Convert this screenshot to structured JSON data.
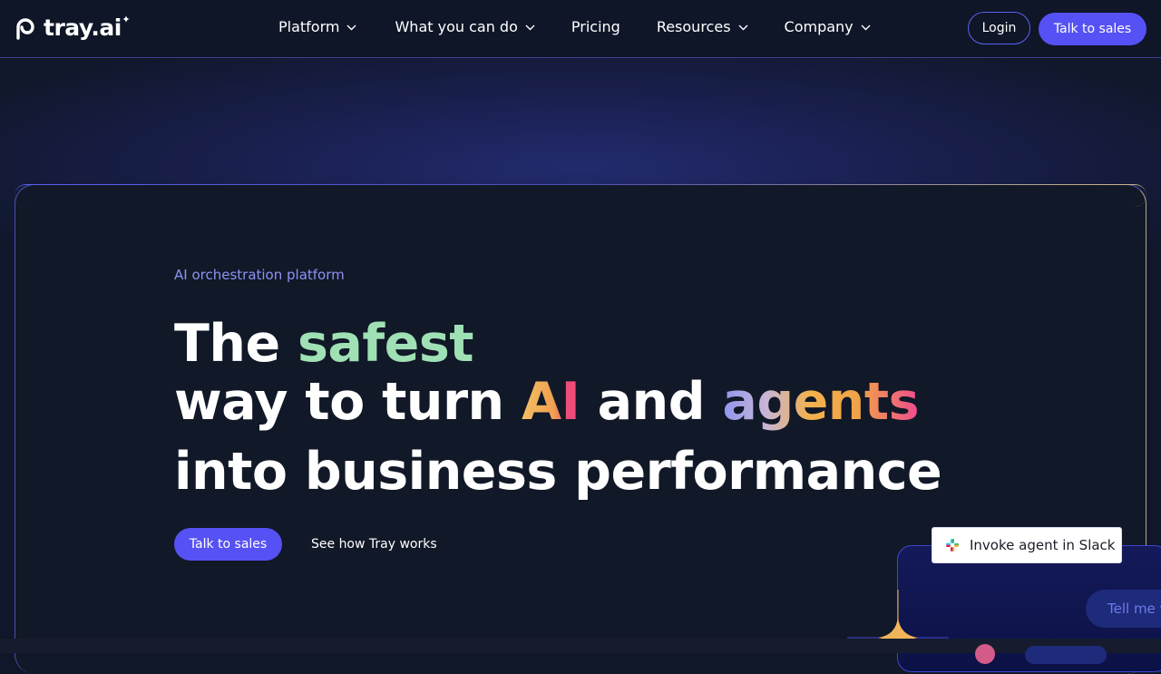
{
  "brand": {
    "name": "tray.ai",
    "logo_icon": "tray-logo-icon",
    "accent_color": "#5651f4"
  },
  "nav": {
    "items": [
      {
        "label": "Platform",
        "has_dropdown": true
      },
      {
        "label": "What you can do",
        "has_dropdown": true
      },
      {
        "label": "Pricing",
        "has_dropdown": false
      },
      {
        "label": "Resources",
        "has_dropdown": true
      },
      {
        "label": "Company",
        "has_dropdown": true
      }
    ],
    "login_label": "Login",
    "sales_label": "Talk to sales"
  },
  "hero": {
    "eyebrow": "AI orchestration platform",
    "headline": {
      "line1_prefix": "The ",
      "line1_highlight": "safest",
      "line2_prefix": "way to turn ",
      "line2_ai": "AI",
      "line2_mid": " and ",
      "line2_agents": "agents",
      "line3": "into business performance"
    },
    "cta_primary": "Talk to sales",
    "cta_secondary": "See how Tray works"
  },
  "widget": {
    "slack_pill_label": "Invoke agent in Slack",
    "slack_icon": "slack-icon",
    "chat_text": "Tell me w"
  }
}
